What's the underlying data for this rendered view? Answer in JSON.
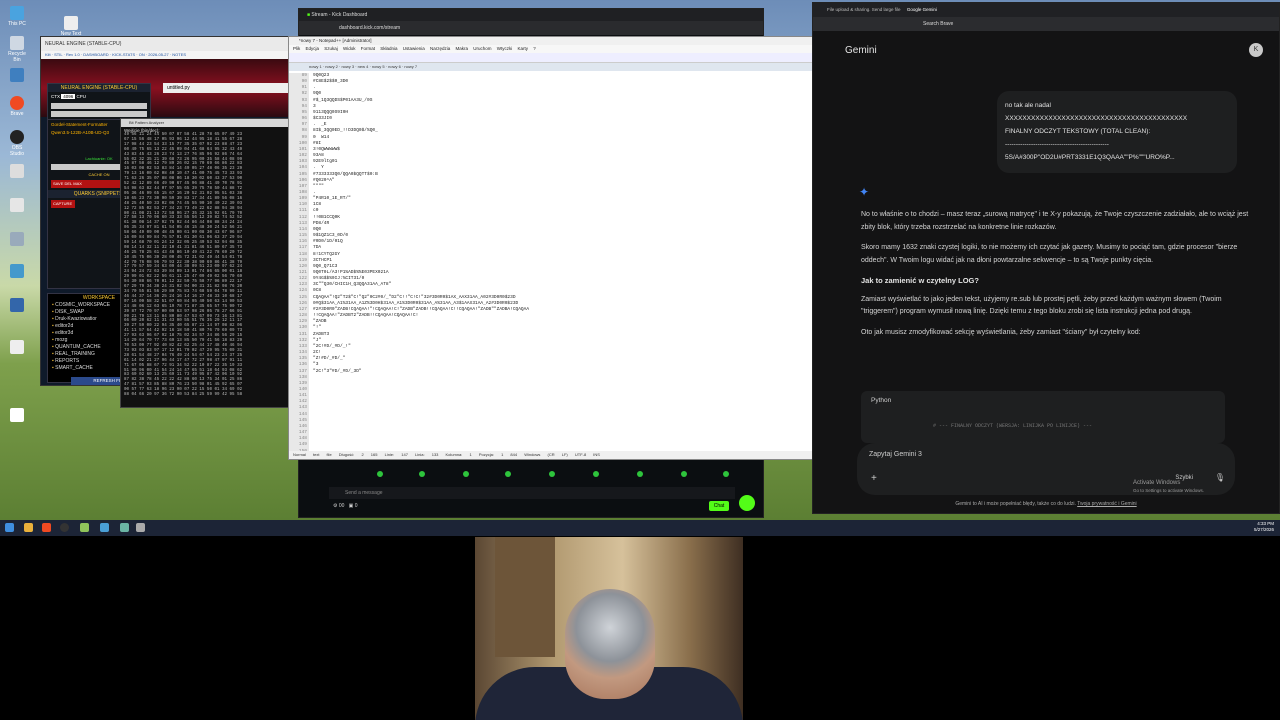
{
  "desktop": {
    "icons": [
      {
        "label": "This PC"
      },
      {
        "label": "Recycle Bin"
      },
      {
        "label": "Brave"
      },
      {
        "label": "Control Panel"
      },
      {
        "label": "OBS Studio"
      },
      {
        "label": "New Text Document"
      }
    ]
  },
  "neuro_app": {
    "title": "NEURAL ENGINE (STABLE-CPU)",
    "tab_strip": "Kilt · STIL · Rev 1.0 · DASHBOARD · KICK-STATS · ON · 2026-05-27 · NOTES",
    "ctx_label": "CTX",
    "ctx_value": "4096",
    "cpu_label": "CPU",
    "file_label": "untitled.py",
    "model_name": "Qwen3.5-122B-A10B-UD-Q3",
    "model_prefix": "Gordel-Statement-Formatter",
    "lachiuanie": "Lachiuanie: OK",
    "cache_label": "CACHE ON",
    "save_row": "SAVE  DEL  MAX",
    "quarks": "QUARKS (SNIPPETS)",
    "capture": "CAPTURE",
    "workspace_header": "WORKSPACE",
    "tree": [
      "COSMIC_WORKSPACE",
      "DISK_SWAP",
      "Druk-Kwaziowatior",
      "editor2d",
      "editor3d",
      "mozg",
      "QUANTUM_CACHE",
      "REAL_TRAINING",
      "REPORTS",
      "SMART_CACHE"
    ],
    "refresh": "REFRESH FILES"
  },
  "hex_window": {
    "title": "Bit Pattern Analyzer",
    "subtitle": "Wejście (bin/dec):"
  },
  "kick": {
    "tab_title": "Stream - Kick Dashboard",
    "url": "dashboard.kick.com/stream",
    "chat_placeholder": "Send a message",
    "chat_button": "Chat",
    "viewers": "00",
    "count": "0"
  },
  "notepad": {
    "title": "*nowy 7 - Notepad++ [Administrator]",
    "menu": "Plik Edycja Szukaj Widok Format Składnia Ustawienia Narzędzia Makra Uruchom Wtyczki Karty ?",
    "file_tabs": "nowy 1 · nowy 2 · nowy 3 · new 4 · nowy 5 · nowy 6 · nowy 7",
    "gutter": "89\n90\n91\n92\n93\n94\n95\n96\n97\n98\n99\n100\n101\n102\n103\n104\n105\n106\n107\n108\n109\n110\n111\n112\n113\n114\n115\n116\n117\n118\n119\n120\n121\n122\n123\n124\n125\n126\n127\n128\n129\n130\n131\n132\n133\n134\n135\n136\n137\n138\n139\n140\n141\n142\n143\n144\n145\n146\n147\n148\n149\n150\n151\n152\n153\n154\n155\n156\n157\n158\n159\n160\n161",
    "code": "9Q0Q23\n#C8E$2$$0_3D0\n.\n9Q0\n#$_1Q3QQDS$P01AA3U_/0S\n3\n9113QQQ0S9I0H\n$C33JI0\n.  _E\n8I$_3QQ0ED_!!D3DQ0$/%Q0_\n0  W14\n#8I\n3!0QWWWWW$\n93A8\n92E9ltg01\n.  Y\n#7333333Q0/QQA0$QQTT$0:B\n#Q020^A\"\n\"\"\"\"\n.\n\"P4R10_1E_RT/\"\n1C8\nc0\n!!0B1CCQ0K\nPD8/4R\n0Q0\n9$1QZ1C3_0D/0\n#0D0/1D/01Q\n7DA\n8!1CYTQ2GY\n3CTHCP1\n9Q0_Q71C3\n9Q0T0L/A3!P1%AD$%%E03PEX021A\n9Y4G$$%0IJ:%CIT31/0\n3C\"\"Q30/CHIC1H_Q3QQA31AA_AT8\"\n0C8\nCQAQAA\"!Q2\"T2$\"C!\"Q2\"0C2#0/_\"D2\"C!!\"C!C!\"32#3D0R0$1AX_AAX31AA_A02#3D0R0$23D\n0#Q$31AA_A1%31AA_A1Z%3D0H$31AA_A1%3D0R0$31AA_A%31AA_A3$1AAX31AA_A2#3D0R0$23D\n#2#3D0R0\"ZADB!CQAQAA!\"!CQAQAA!C!\"ZADB\"ZADB!!CQAQAA!C!!CQAQAA!\"ZADB\"\"ZADBA!CQAQAA\n!!CQAQAA!\"ZADBT2\"ZADB!!CQAQAA!CQAQAA!C!\n\"ZADB\n\"!\"\nZADBT3\n\"J\"\n\"2C!#D/_#D/_!\"\n2C!\n\"Z!#D/_#D/_\"\n\"3\n\"2C!\"3\"#D/_#D/_3D\"",
    "status": "Normal text file   Długość: 2 165   Linie: 147   Linia: 133   Kolumna: 1   Pozycja: 1 844   Windows (CR LF)   UTF-8   INS"
  },
  "gemini": {
    "tab1": "File upload & sharing. Send large file",
    "tab2": "Google Gemini",
    "url": "Search Brave",
    "app_title": "Gemini",
    "user_msg_1": "no tak ale nadal",
    "user_msg_2": "XXXXXXXXXXXXXXXXXXXXXXXXXXXXXXXXXXXXXXXXXX",
    "user_msg_3": "FINALNY ODCZYT TEKSTOWY (TOTAL CLEAN):",
    "user_msg_4": "------------------------------------------------",
    "user_msg_5": "5S/A#300P\"OD2U#PRT3331E1Q3QAAA\"\"P%\"\"\"URO%P...",
    "p1": "No to właśnie o to chodzi – masz teraz „surową matrycę\" i te X-y pokazują, że Twoje czyszczenie zadziałało, ale to wciąż jest zbity blok, który trzeba rozstrzelać na konkretne linie rozkazów.",
    "p2": "Skoro mamy 1632 znaki czystej logiki, to nie możemy ich czytać jak gazety. Musimy to pociąć tam, gdzie procesor \"bierze oddech\". W Twoim logu widać jak na dłoni powtarzalne sekwencje – to są Twoje punkty cięcia.",
    "h": "Jak to zamienić w czytelny LOG?",
    "p3": "Zamiast wyświetlać to jako jeden tekst, użyjemy re.sub lub prostej pętli, żeby przed każdym ważnym słowem (Twoim \"triggerem\") program wymusił nową linię. Dzięki temu z tego bloku zrobi się lista instrukcji jedna pod drugą.",
    "p4": "Oto jak musisz zmodyfikować sekcję wyświetlania, żeby zamiast \"ściany\" był czytelny kod:",
    "code_lang": "Python",
    "code_line": "# --- FINALNY ODCZYT (WERSJA: LINIJKA PO LINIJCE) ---",
    "prompt_placeholder": "Zapytaj Gemini 3",
    "mode": "Szybki",
    "footer": "Gemini to AI i może popełniać błędy, także co do ludzi.",
    "footer_link": "Twoja prywatność i Gemini",
    "activate1": "Activate Windows",
    "activate2": "Go to Settings to activate Windows."
  },
  "taskbar": {
    "time": "4:33 PM",
    "date": "5/27/2026"
  },
  "colors": {
    "kick_green": "#53fc18",
    "gemini_bg": "#131314",
    "gemini_star": "#4285f4"
  }
}
